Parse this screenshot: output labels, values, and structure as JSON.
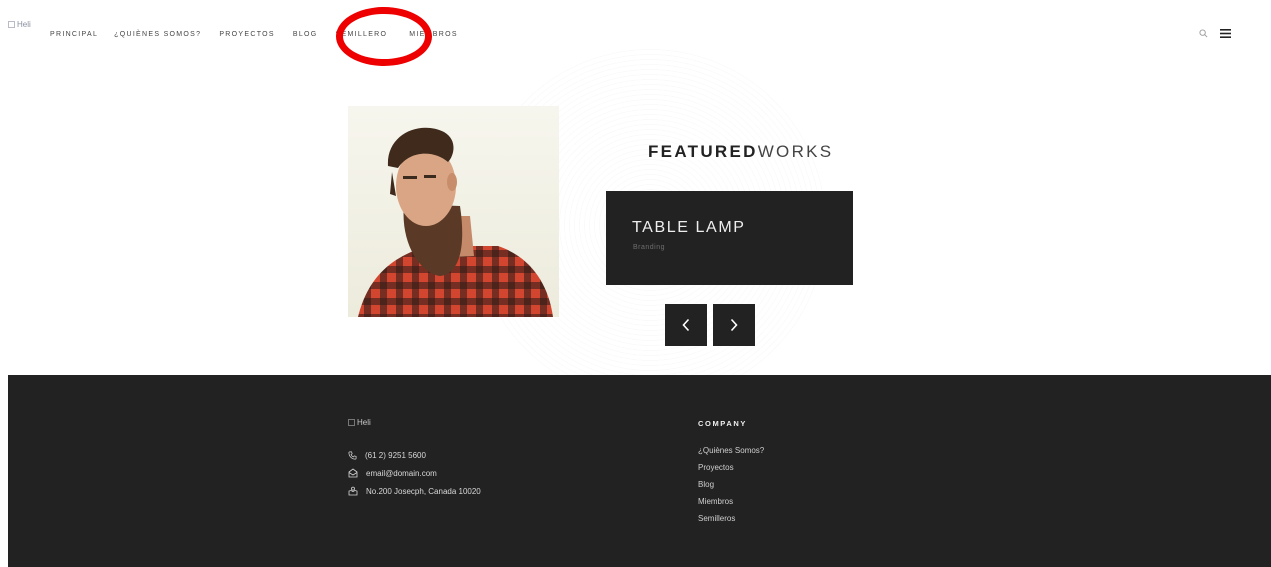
{
  "header": {
    "logo_alt": "Heli",
    "nav": [
      {
        "label": "PRINCIPAL"
      },
      {
        "label": "¿QUIÈNES SOMOS?"
      },
      {
        "label": "PROYECTOS"
      },
      {
        "label": "BLOG"
      },
      {
        "label": "SEMILLERO"
      },
      {
        "label": "MIEMBROS"
      }
    ],
    "highlighted_item": "MIEMBROS",
    "highlight_color": "#ee0000",
    "icons": [
      "search-icon",
      "menu-icon"
    ]
  },
  "hero": {
    "image": "portrait-photo-bearded-man",
    "heading_bold": "FEATURED",
    "heading_light": "WORKS",
    "card": {
      "title": "TABLE LAMP",
      "subtitle": "Branding"
    },
    "controls": [
      "chevron-left-icon",
      "chevron-right-icon"
    ]
  },
  "footer": {
    "background": "#222222",
    "logo_alt": "Heli",
    "contact": {
      "phone": "(61 2) 9251 5600",
      "email": "email@domain.com",
      "address": "No.200 Josecph, Canada 10020"
    },
    "company": {
      "heading": "COMPANY",
      "links": [
        "¿Quiènes Somos?",
        "Proyectos",
        "Blog",
        "Miembros",
        "Semilleros"
      ]
    }
  }
}
